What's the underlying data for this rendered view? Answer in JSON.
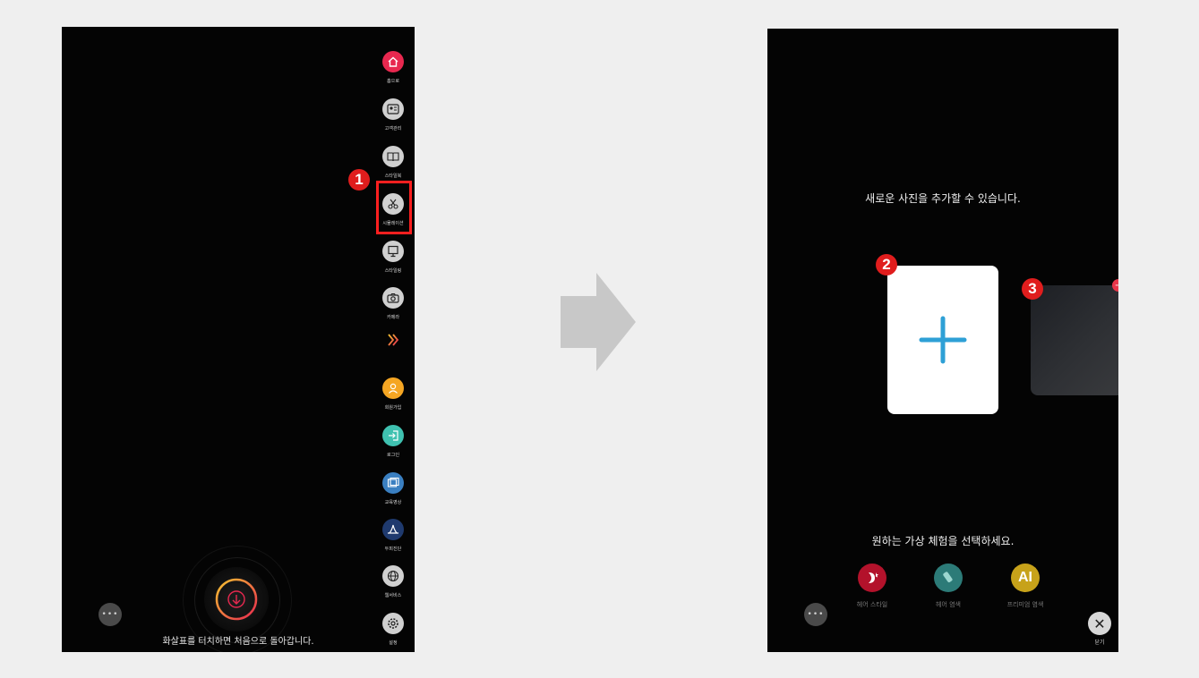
{
  "left_screen": {
    "sidebar": {
      "items": [
        {
          "label": "홈으로",
          "icon": "home-icon",
          "color": "#e8284f"
        },
        {
          "label": "고객관리",
          "icon": "customer-card-icon",
          "color": "#d0d0d0"
        },
        {
          "label": "스타일북",
          "icon": "book-icon",
          "color": "#d0d0d0"
        },
        {
          "label": "시뮬레이션",
          "icon": "scissors-icon",
          "color": "#d0d0d0"
        },
        {
          "label": "스타일링",
          "icon": "monitor-icon",
          "color": "#d0d0d0"
        },
        {
          "label": "카메라",
          "icon": "camera-icon",
          "color": "#d0d0d0"
        },
        {
          "label": "회원가입",
          "icon": "user-icon",
          "color": "#f5a623"
        },
        {
          "label": "로그인",
          "icon": "login-icon",
          "color": "#3fc1b0"
        },
        {
          "label": "교육영상",
          "icon": "video-icon",
          "color": "#3a7fc1"
        },
        {
          "label": "두피진단",
          "icon": "scalp-icon",
          "color": "#1f3a6e"
        },
        {
          "label": "웹서비스",
          "icon": "globe-icon",
          "color": "#d0d0d0"
        },
        {
          "label": "설정",
          "icon": "settings-icon",
          "color": "#d0d0d0"
        }
      ],
      "expand_icon": "double-chevron-right-icon"
    },
    "highlight_badge": "1",
    "bottom_text": "화살표를 터치하면 처음으로 돌아갑니다.",
    "more_label": "•••",
    "home_button_icon": "down-arrow-icon"
  },
  "transition_arrow": "right-arrow-icon",
  "right_screen": {
    "title": "새로운 사진을 추가할 수 있습니다.",
    "badge_add": "2",
    "badge_photo": "3",
    "add_symbol": "+",
    "prompt": "원하는 가상 체험을 선택하세요.",
    "experiences": [
      {
        "label": "헤어 스타일",
        "icon": "hair-style-icon",
        "color": "#b3122b"
      },
      {
        "label": "헤어 염색",
        "icon": "hair-dye-icon",
        "color": "#2c7b78"
      },
      {
        "label": "프리미엄 염색",
        "icon_text": "AI",
        "color": "#c7a21a"
      }
    ],
    "more_label": "•••",
    "close_label": "닫기",
    "close_symbol": "✕"
  }
}
